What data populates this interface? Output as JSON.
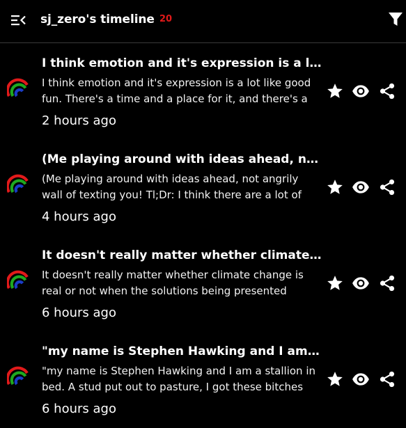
{
  "header": {
    "menu_icon": "menu-collapse-icon",
    "title": "sj_zero's timeline",
    "badge_count": "20",
    "filter_icon": "filter-icon",
    "badge_color": "#e01919"
  },
  "posts": [
    {
      "title": "I think emotion and it's expression is a lot li...",
      "body": "I think emotion and it's expression is a lot like good fun. There's a time and a place for it, and there's a",
      "time": "2 hours ago"
    },
    {
      "title": "(Me playing around with ideas ahead, not a...",
      "body": "(Me playing around with ideas ahead, not angrily wall of texting you! Tl;Dr: I think there are a lot of ways we",
      "time": "4 hours ago"
    },
    {
      "title": "It doesn't really matter whether climate cha...",
      "body": "It doesn't really matter whether climate change is real or not when the solutions being presented seems so",
      "time": "6 hours ago"
    },
    {
      "title": "\"my name is Stephen Hawking and I am a s...",
      "body": "\"my name is Stephen Hawking and I am a stallion in bed. A stud put out to pasture, I got these bitches",
      "time": "6 hours ago"
    }
  ],
  "actions": {
    "star_icon": "star-icon",
    "view_icon": "eye-icon",
    "share_icon": "share-icon"
  }
}
